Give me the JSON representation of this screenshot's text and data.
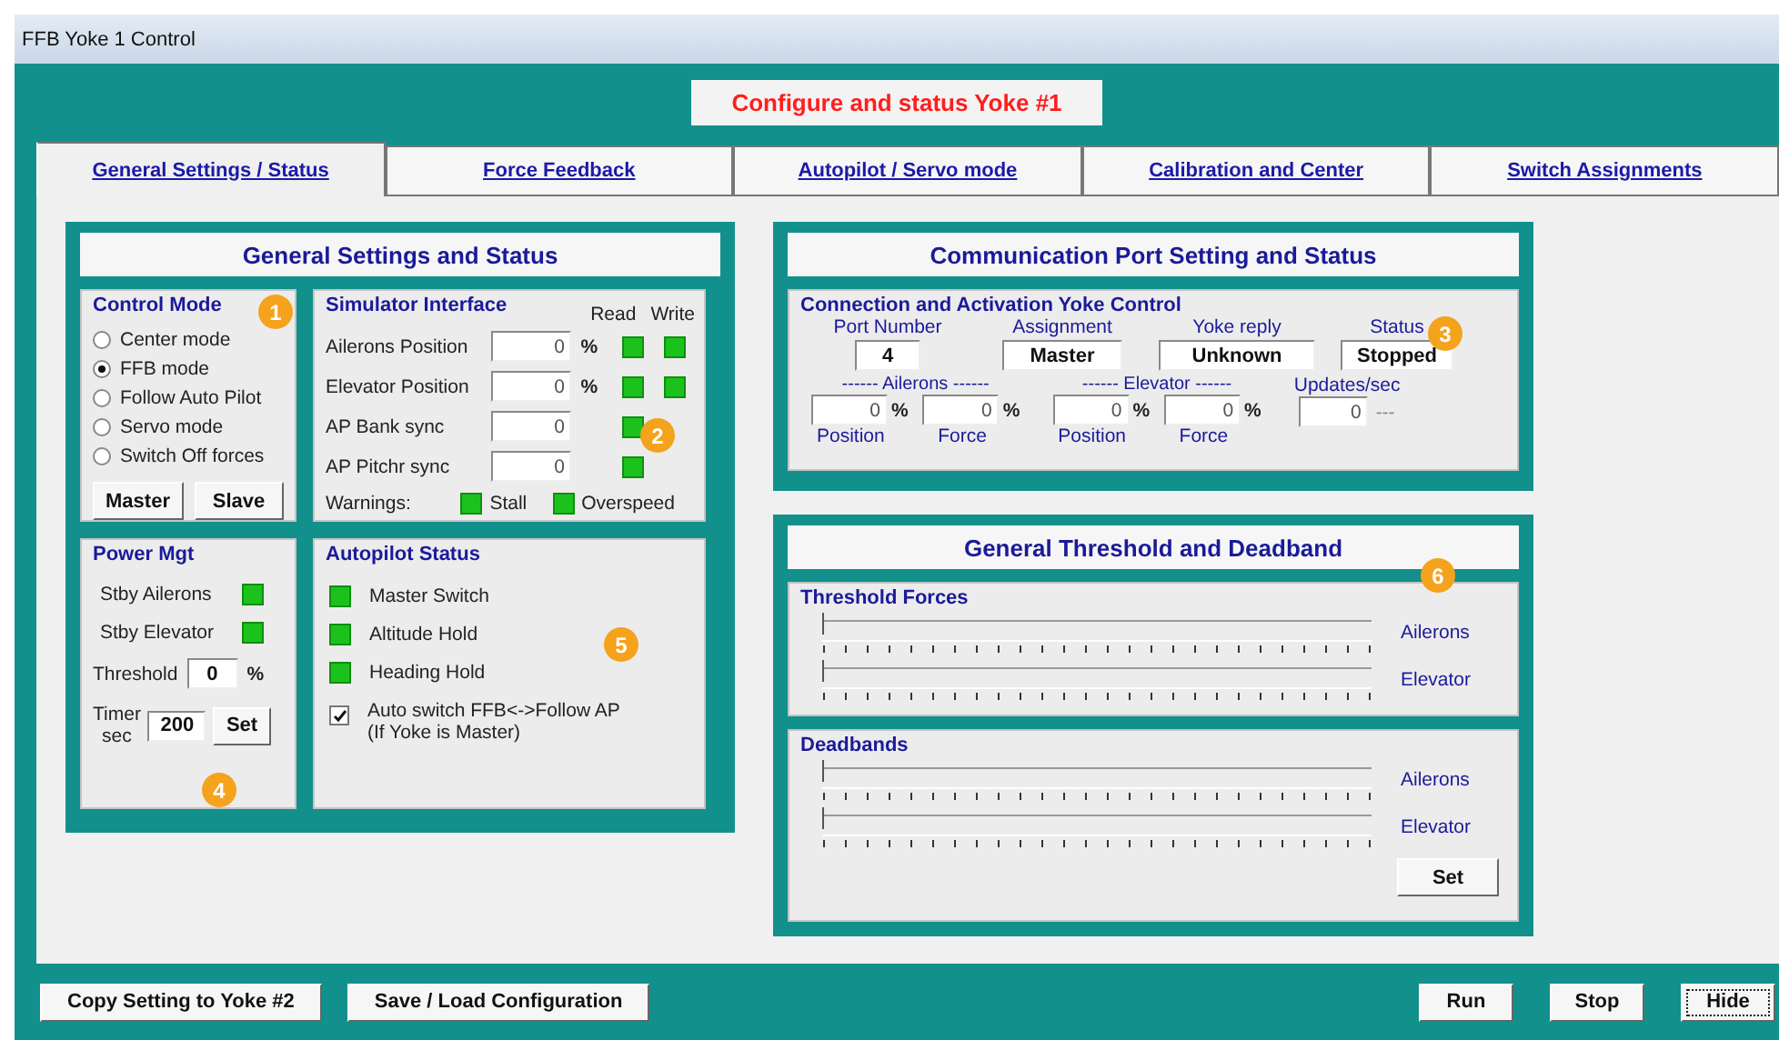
{
  "window": {
    "title": "FFB Yoke 1 Control"
  },
  "header": "Configure and status Yoke #1",
  "tabs": [
    {
      "label": "General Settings / Status",
      "selected": true
    },
    {
      "label": "Force Feedback",
      "selected": false
    },
    {
      "label": "Autopilot / Servo mode",
      "selected": false
    },
    {
      "label": "Calibration and Center",
      "selected": false
    },
    {
      "label": "Switch Assignments",
      "selected": false
    }
  ],
  "general": {
    "title": "General Settings and Status",
    "control_mode": {
      "title": "Control Mode",
      "marker": "1",
      "options": [
        {
          "label": "Center mode",
          "selected": false
        },
        {
          "label": "FFB mode",
          "selected": true
        },
        {
          "label": "Follow Auto Pilot",
          "selected": false
        },
        {
          "label": "Servo mode",
          "selected": false
        },
        {
          "label": "Switch Off  forces",
          "selected": false
        }
      ],
      "buttons": [
        "Master",
        "Slave"
      ]
    },
    "simulator": {
      "title": "Simulator Interface",
      "marker": "2",
      "columns": [
        "Read",
        "Write"
      ],
      "rows": [
        {
          "label": "Ailerons Position",
          "value": "0",
          "unit": "%",
          "read": true,
          "write": true
        },
        {
          "label": "Elevator Position",
          "value": "0",
          "unit": "%",
          "read": true,
          "write": true
        },
        {
          "label": "AP Bank sync",
          "value": "0",
          "read": true
        },
        {
          "label": "AP Pitchr sync",
          "value": "0",
          "read": true
        }
      ],
      "warnings": {
        "label": "Warnings:",
        "items": [
          {
            "label": "Stall",
            "on": true
          },
          {
            "label": "Overspeed",
            "on": true
          }
        ]
      }
    },
    "power": {
      "title": "Power Mgt",
      "marker": "4",
      "rows": [
        {
          "label": "Stby Ailerons",
          "on": true
        },
        {
          "label": "Stby Elevator",
          "on": true
        }
      ],
      "threshold": {
        "label": "Threshold",
        "value": "0",
        "unit": "%"
      },
      "timer": {
        "label": "Timer",
        "sublabel": "sec",
        "value": "200",
        "button": "Set"
      }
    },
    "autopilot": {
      "title": "Autopilot Status",
      "marker": "5",
      "items": [
        {
          "label": "Master Switch",
          "on": true
        },
        {
          "label": "Altitude Hold",
          "on": true
        },
        {
          "label": "Heading Hold",
          "on": true
        }
      ],
      "auto_switch": {
        "label": "Auto switch FFB<->Follow AP\n(If Yoke is Master)",
        "checked": true
      }
    }
  },
  "comm": {
    "title": "Communication Port Setting and Status",
    "connection": {
      "title": "Connection and Activation Yoke Control",
      "marker": "3",
      "fields": [
        {
          "label": "Port Number",
          "value": "4"
        },
        {
          "label": "Assignment",
          "value": "Master"
        },
        {
          "label": "Yoke reply",
          "value": "Unknown"
        },
        {
          "label": "Status",
          "value": "Stopped"
        }
      ],
      "groups": [
        {
          "caption": "------ Ailerons ------",
          "fields": [
            {
              "value": "0",
              "unit": "%",
              "label": "Position"
            },
            {
              "value": "0",
              "unit": "%",
              "label": "Force"
            }
          ]
        },
        {
          "caption": "------ Elevator ------",
          "fields": [
            {
              "value": "0",
              "unit": "%",
              "label": "Position"
            },
            {
              "value": "0",
              "unit": "%",
              "label": "Force"
            }
          ]
        }
      ],
      "updates": {
        "label": "Updates/sec",
        "value": "0",
        "suffix": "---"
      }
    }
  },
  "deadband": {
    "title": "General Threshold and Deadband",
    "marker": "6",
    "groups": [
      {
        "title": "Threshold Forces",
        "sliders": [
          {
            "label": "Ailerons",
            "level": 0
          },
          {
            "label": "Elevator",
            "level": 0
          }
        ]
      },
      {
        "title": "Deadbands",
        "sliders": [
          {
            "label": "Ailerons",
            "level": 0
          },
          {
            "label": "Elevator",
            "level": 0
          }
        ]
      }
    ],
    "button": "Set"
  },
  "footer": {
    "left": [
      {
        "label": "Copy Setting to Yoke #2",
        "focused": false
      },
      {
        "label": "Save / Load  Configuration",
        "focused": false
      }
    ],
    "right": [
      {
        "label": "Run",
        "focused": false
      },
      {
        "label": "Stop",
        "focused": false
      },
      {
        "label": "Hide",
        "focused": true
      }
    ]
  }
}
